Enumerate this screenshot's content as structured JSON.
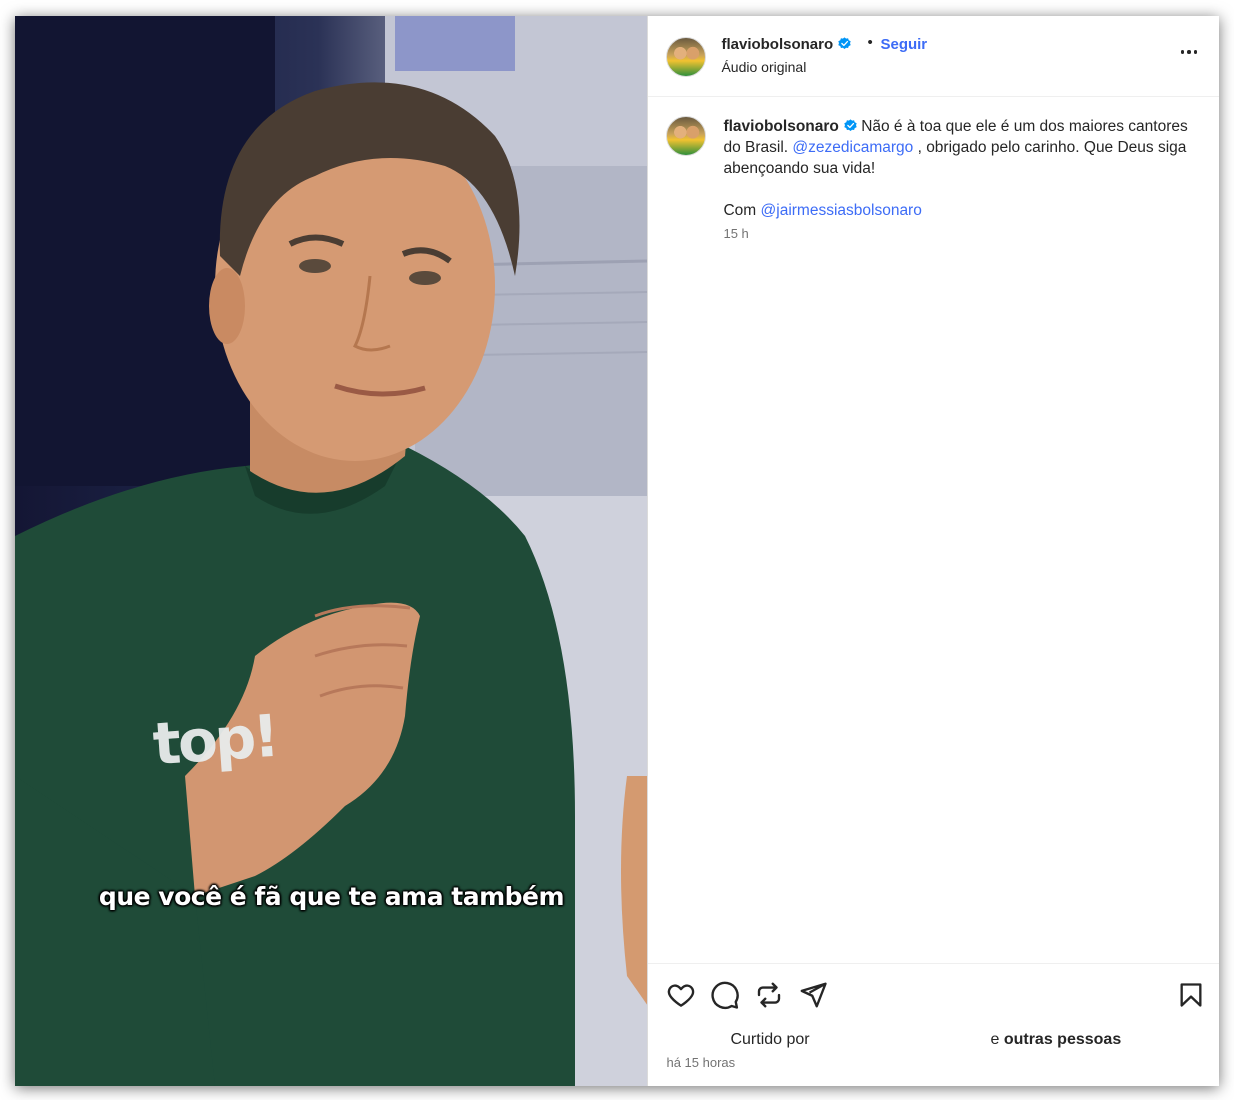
{
  "post": {
    "username": "flaviobolsonaro",
    "follow_label": "Seguir",
    "separator": "•",
    "audio": "Áudio original",
    "more_label": "Mais opções"
  },
  "media": {
    "subtitle": "que você é fã que te ama também",
    "shirt_text": "top!"
  },
  "caption": {
    "username": "flaviobolsonaro",
    "text_part1": "Não é à toa que ele é um dos maiores cantores do Brasil.",
    "mention1": "@zezedicamargo",
    "text_part2": ", obrigado pelo carinho. Que Deus siga abençoando sua vida!",
    "with_label": "Com",
    "mention2": "@jairmessiasbolsonaro",
    "time": "15 h"
  },
  "footer": {
    "liked_by": "Curtido por",
    "others_prefix": "e",
    "others": "outras pessoas",
    "ago": "há 15 horas"
  },
  "colors": {
    "link": "#3d6cf6",
    "verified": "#0095f6",
    "text": "#262626",
    "muted": "#737373"
  }
}
